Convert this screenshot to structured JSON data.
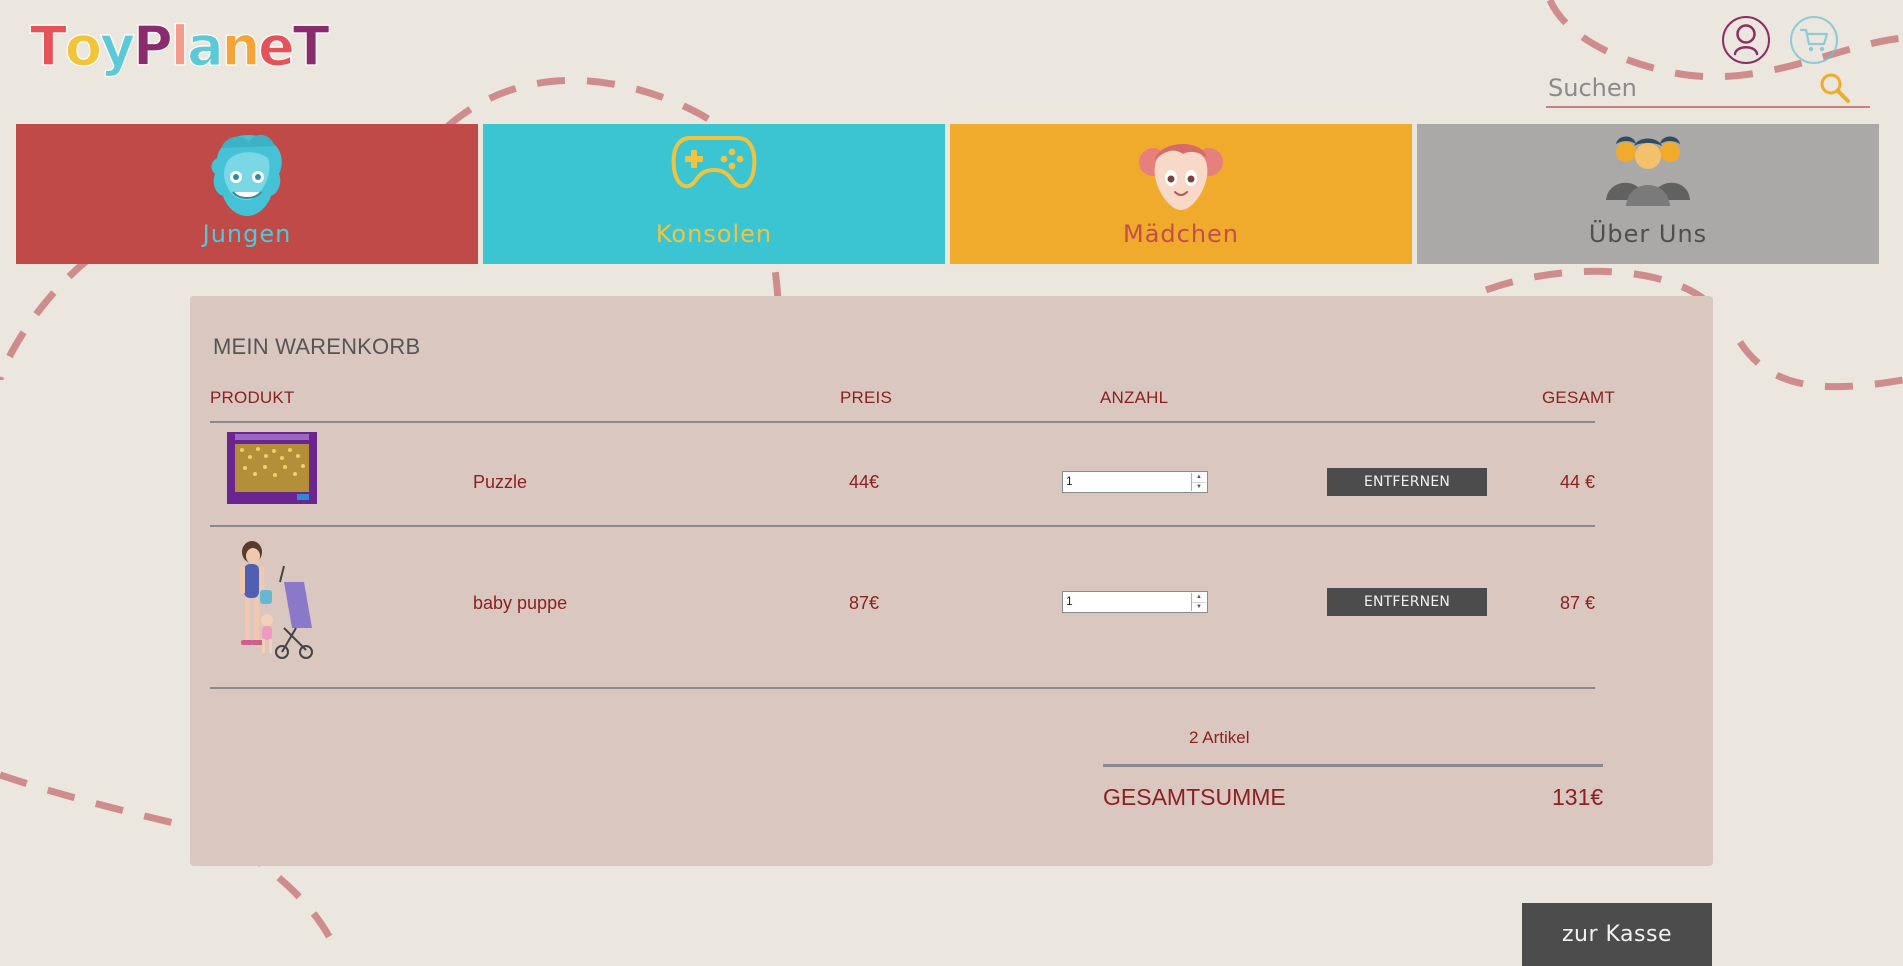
{
  "brand": {
    "letters": [
      "T",
      "o",
      "y",
      "P",
      "l",
      "a",
      "n",
      "e",
      "T"
    ],
    "colors": [
      "#e4525a",
      "#f1c43a",
      "#5bcad6",
      "#8a2b6d",
      "#f59b8a",
      "#5bcad6",
      "#f6a338",
      "#e4525a",
      "#8a2b6d"
    ]
  },
  "header": {
    "account_icon": "user-icon",
    "cart_icon": "cart-icon",
    "search": {
      "placeholder": "Suchen",
      "icon": "search-icon"
    }
  },
  "categories": [
    {
      "label": "Jungen",
      "icon": "boy-face-icon",
      "background": "#c04a47",
      "label_color": "#4fc8d8"
    },
    {
      "label": "Konsolen",
      "icon": "gamepad-icon",
      "background": "#3bc5d3",
      "label_color": "#f0c43f"
    },
    {
      "label": "Mädchen",
      "icon": "girl-face-icon",
      "background": "#f0ab2d",
      "label_color": "#c34e4a"
    },
    {
      "label": "Über Uns",
      "icon": "team-icon",
      "background": "#aaa9a7",
      "label_color": "#4f4f4f"
    }
  ],
  "cart": {
    "title": "MEIN WARENKORB",
    "columns": {
      "product": "PRODUKT",
      "price": "PREIS",
      "quantity": "ANZAHL",
      "total": "GESAMT"
    },
    "items": [
      {
        "name": "Puzzle",
        "price": "44€",
        "quantity": "1",
        "remove_label": "ENTFERNEN",
        "total": "44 €",
        "image": "puzzle-box-image"
      },
      {
        "name": "baby puppe",
        "price": "87€",
        "quantity": "1",
        "remove_label": "ENTFERNEN",
        "total": "87 €",
        "image": "doll-stroller-image"
      }
    ],
    "summary": {
      "count_text": "2 Artikel",
      "total_label": "GESAMTSUMME",
      "total_value": "131€"
    }
  },
  "checkout": {
    "label": "zur Kasse"
  }
}
